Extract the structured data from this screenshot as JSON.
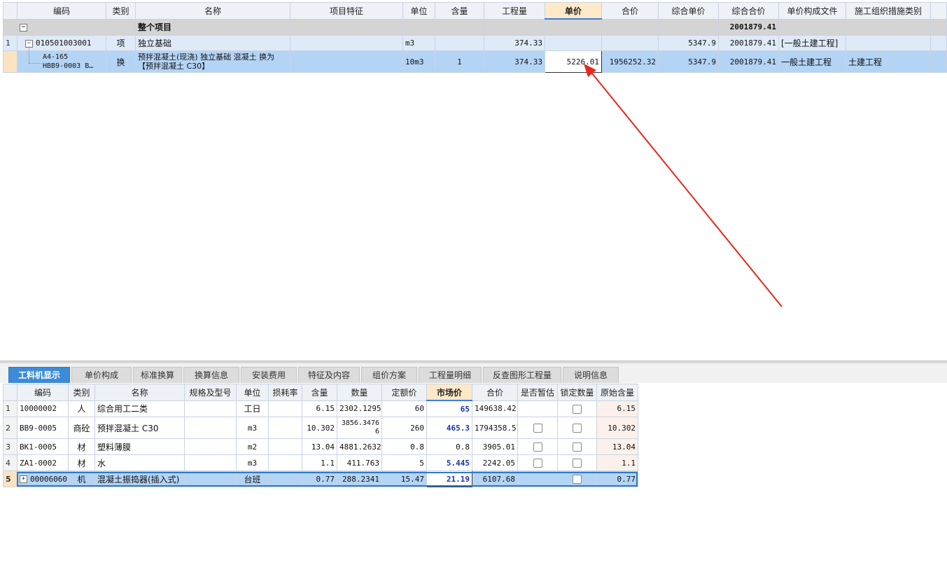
{
  "top_grid": {
    "headers": [
      "编码",
      "类别",
      "名称",
      "项目特征",
      "单位",
      "含量",
      "工程量",
      "单价",
      "合价",
      "综合单价",
      "综合合价",
      "单价构成文件",
      "施工组织措施类别"
    ],
    "total_row": {
      "name": "整个项目",
      "comp_total": "2001879.41"
    },
    "project_row": {
      "index": "1",
      "code": "010501003001",
      "type": "项",
      "name": "独立基础",
      "unit": "m3",
      "qty": "374.33",
      "comp_unit": "5347.9",
      "comp_total": "2001879.41",
      "price_file": "[一般土建工程]"
    },
    "sub_row": {
      "code_line1": "A4-165",
      "code_line2": "HBB9-0003 B…",
      "type": "换",
      "name": "预拌混凝土(现浇) 独立基础 混凝土  换为【预拌混凝土 C30】",
      "unit": "10m3",
      "content": "1",
      "qty": "374.33",
      "unit_price": "5226.01",
      "total": "1956252.32",
      "comp_unit": "5347.9",
      "comp_total": "2001879.41",
      "price_file": "一般土建工程",
      "measure_type": "土建工程"
    }
  },
  "tabs": [
    "工料机显示",
    "单价构成",
    "标准换算",
    "换算信息",
    "安装费用",
    "特征及内容",
    "组价方案",
    "工程量明细",
    "反查图形工程量",
    "说明信息"
  ],
  "bottom_grid": {
    "headers": [
      "编码",
      "类别",
      "名称",
      "规格及型号",
      "单位",
      "损耗率",
      "含量",
      "数量",
      "定额价",
      "市场价",
      "合价",
      "是否暂估",
      "锁定数量",
      "原始含量"
    ],
    "rows": [
      {
        "index": "1",
        "code": "10000002",
        "type": "人",
        "name": "综合用工二类",
        "spec": "",
        "unit": "工日",
        "loss": "",
        "content": "6.15",
        "qty": "2302.1295",
        "quota": "60",
        "market": "65",
        "total": "149638.42",
        "orig": "6.15"
      },
      {
        "index": "2",
        "code": "BB9-0005",
        "type": "商砼",
        "name": "预拌混凝土 C30",
        "spec": "",
        "unit": "m3",
        "loss": "",
        "content": "10.302",
        "qty": "3856.34766",
        "quota": "260",
        "market": "465.3",
        "total": "1794358.57",
        "orig": "10.302"
      },
      {
        "index": "3",
        "code": "BK1-0005",
        "type": "材",
        "name": "塑料薄膜",
        "spec": "",
        "unit": "m2",
        "loss": "",
        "content": "13.04",
        "qty": "4881.2632",
        "quota": "0.8",
        "market": "0.8",
        "total": "3905.01",
        "orig": "13.04"
      },
      {
        "index": "4",
        "code": "ZA1-0002",
        "type": "材",
        "name": "水",
        "spec": "",
        "unit": "m3",
        "loss": "",
        "content": "1.1",
        "qty": "411.763",
        "quota": "5",
        "market": "5.445",
        "total": "2242.05",
        "orig": "1.1"
      },
      {
        "index": "5",
        "code": "00006060",
        "type": "机",
        "name": "混凝土振捣器(插入式)",
        "spec": "",
        "unit": "台班",
        "loss": "",
        "content": "0.77",
        "qty": "288.2341",
        "quota": "15.47",
        "market": "21.19",
        "total": "6107.68",
        "orig": "0.77"
      }
    ]
  },
  "colors": {
    "accent": "#3b8bd9",
    "selected_row": "#b4d4f5",
    "header_highlight": "#fde9c7",
    "annotation_arrow": "#e8281c",
    "market_price_text": "#1730b5"
  }
}
